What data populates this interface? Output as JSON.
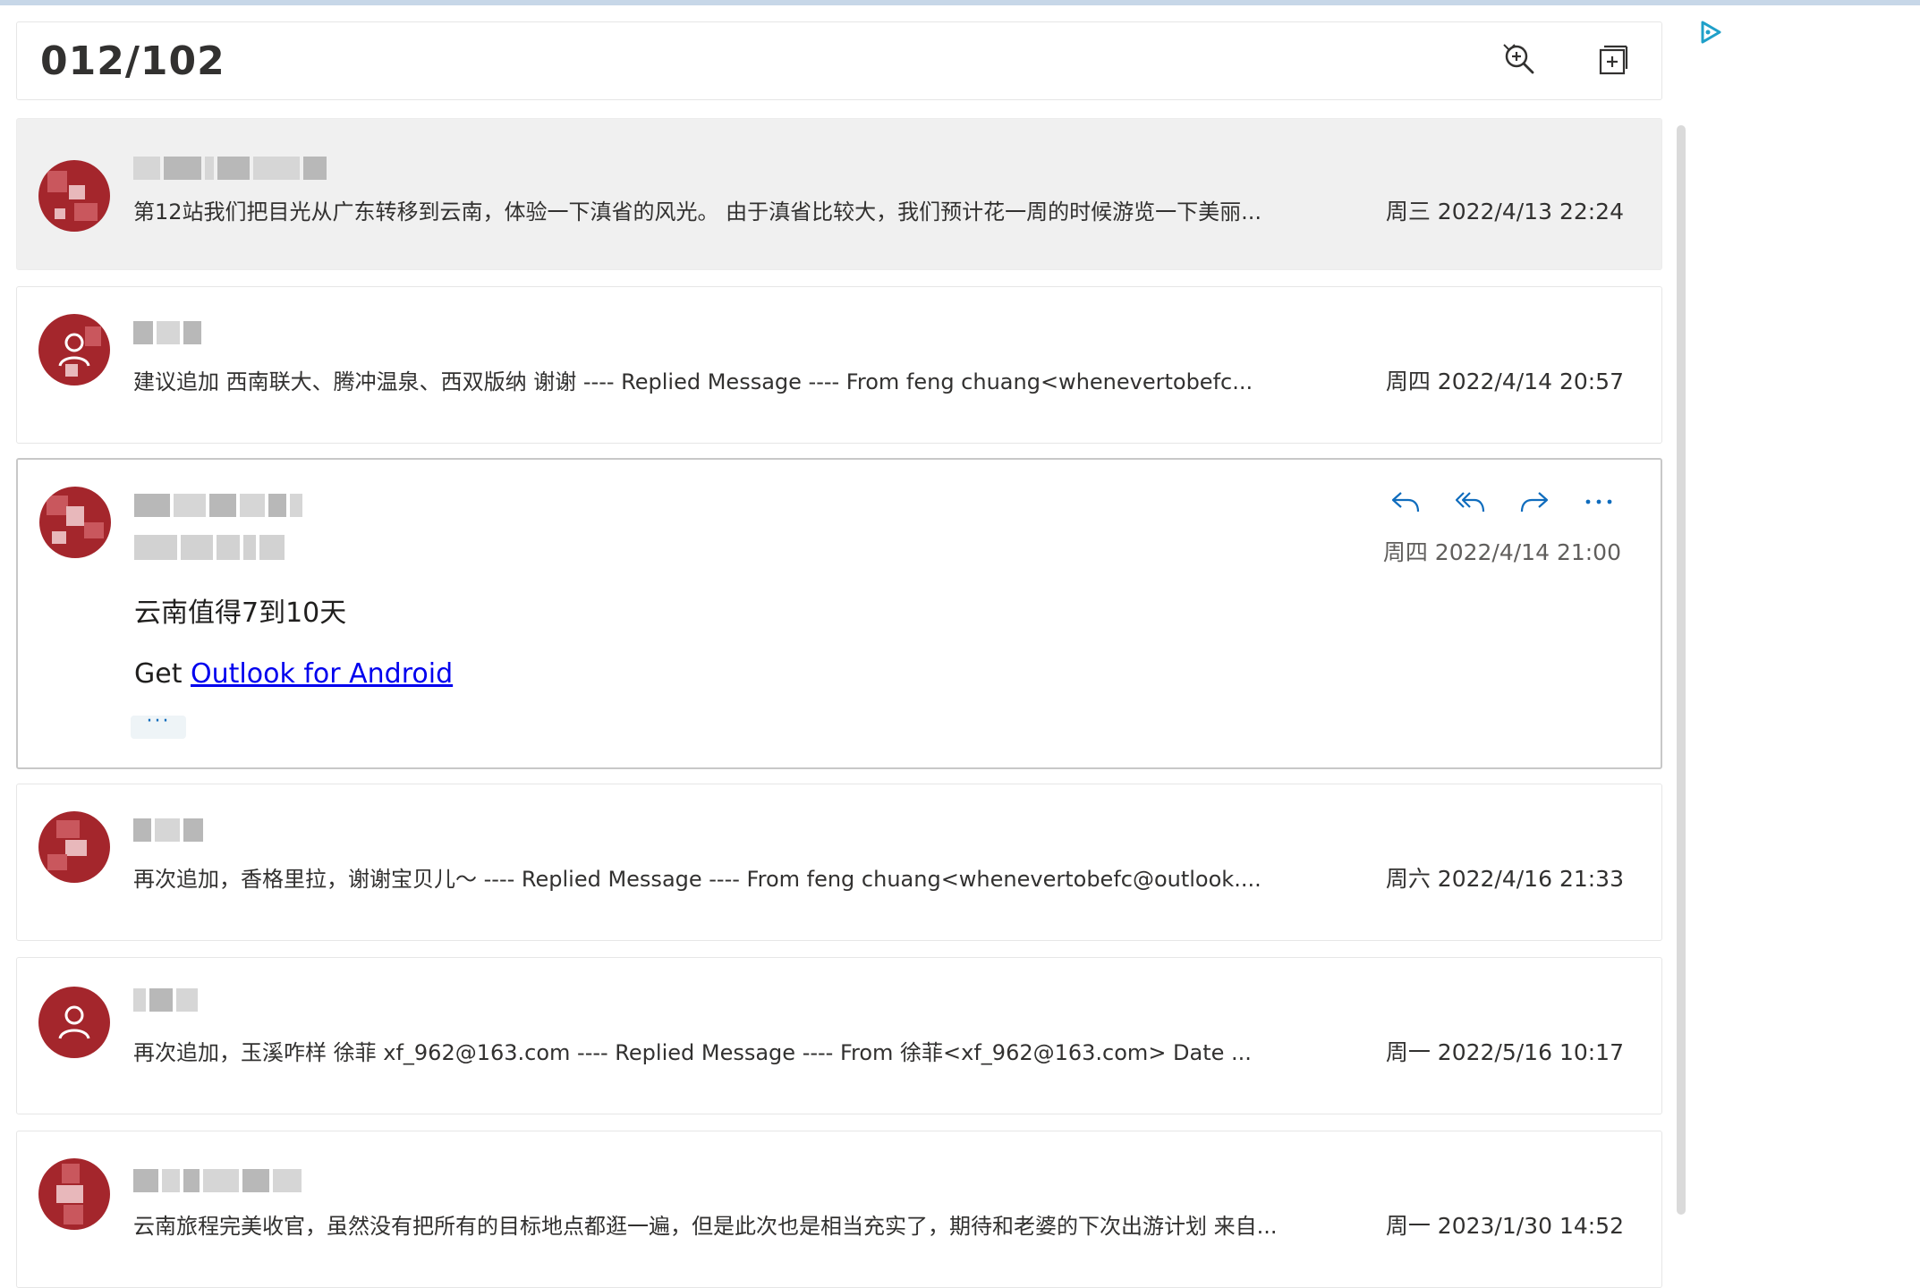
{
  "thread": {
    "title": "012/102"
  },
  "toolbar": {
    "zoom_icon": "zoom-in-icon",
    "expand_icon": "open-in-new-window-icon"
  },
  "messages": [
    {
      "preview": "第12站我们把目光从广东转移到云南，体验一下滇省的风光。 由于滇省比较大，我们预计花一周的时候游览一下美丽...",
      "date": "周三 2022/4/13 22:24"
    },
    {
      "preview": "建议追加 西南联大、腾冲温泉、西双版纳 谢谢 ---- Replied Message ---- From feng chuang<whenevertobefc...",
      "date": "周四 2022/4/14 20:57"
    },
    {
      "date": "周四 2022/4/14 21:00",
      "body_line1": "云南值得7到10天",
      "body_get": "Get ",
      "body_link": "Outlook for Android",
      "more": "···"
    },
    {
      "preview": "再次追加，香格里拉，谢谢宝贝儿～ ---- Replied Message ---- From feng chuang<whenevertobefc@outlook....",
      "date": "周六 2022/4/16 21:33"
    },
    {
      "preview": "再次追加，玉溪咋样 徐菲 xf_962@163.com ---- Replied Message ---- From 徐菲<xf_962@163.com> Date ...",
      "date": "周一 2022/5/16 10:17"
    },
    {
      "preview": "云南旅程完美收官，虽然没有把所有的目标地点都逛一遍，但是此次也是相当充实了，期待和老婆的下次出游计划 来自...",
      "date": "周一 2023/1/30 14:52"
    }
  ],
  "actions": {
    "reply": "reply-icon",
    "reply_all": "reply-all-icon",
    "forward": "forward-icon",
    "more": "more-icon"
  },
  "colors": {
    "avatar": "#a4262c",
    "accent": "#0f6cbd",
    "selected_bg": "#f0f0f0"
  }
}
